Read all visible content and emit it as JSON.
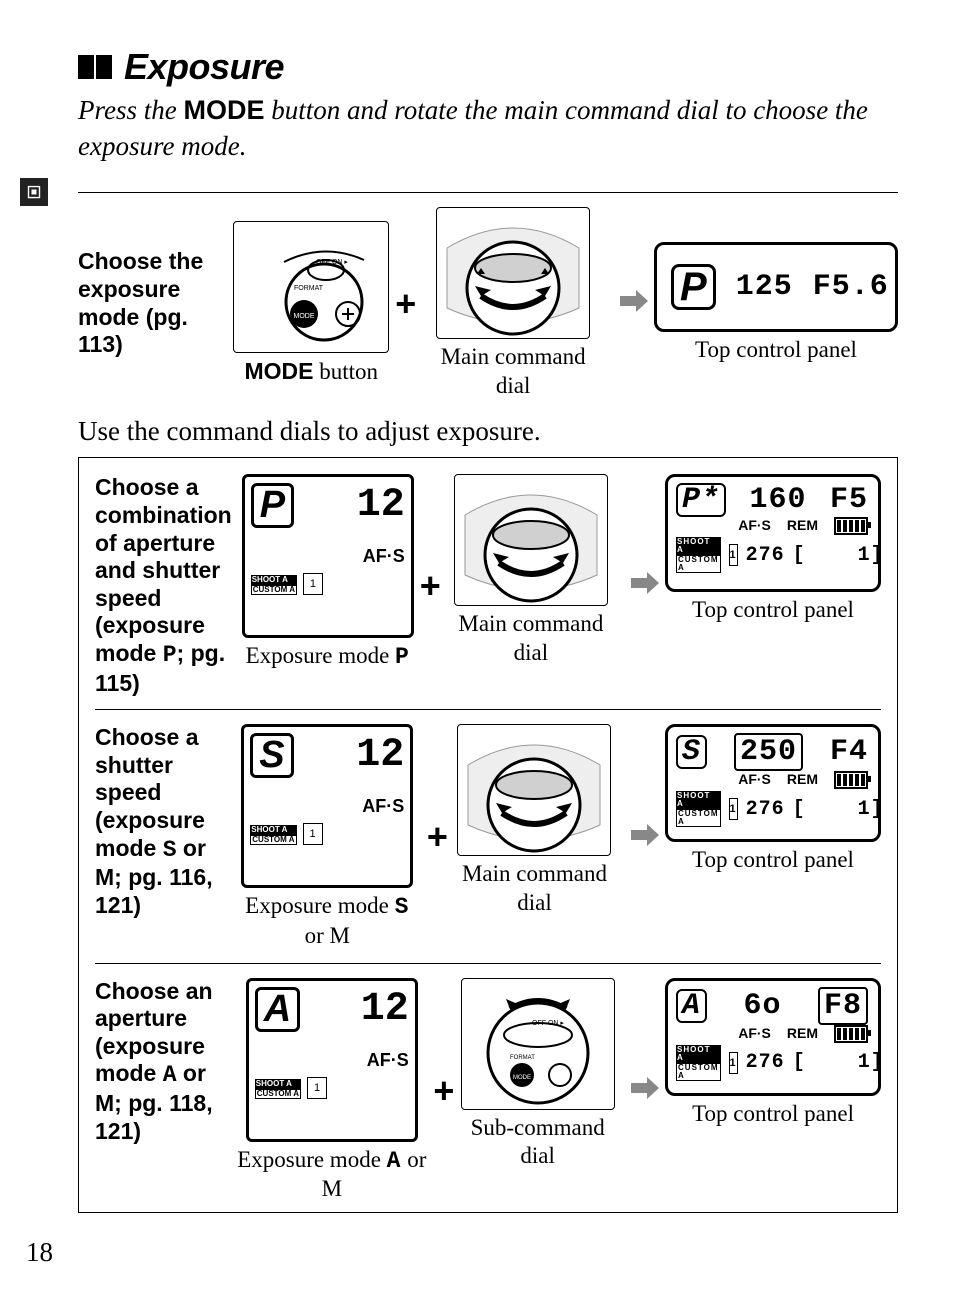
{
  "pageNumber": "18",
  "heading": "Exposure",
  "intro_prefix": "Press the ",
  "intro_mode": "MODE",
  "intro_suffix": " button and rotate the main command dial to choose the exposure mode.",
  "row1": {
    "desc": "Choose the exposure mode (pg. 113)",
    "cap1_pre": "",
    "cap1_mode": "MODE",
    "cap1_post": " button",
    "cap2": "Main command dial",
    "cap3": "Top control panel",
    "lcd_mode": "P",
    "lcd_shutter": "125",
    "lcd_aperture": "F5.6"
  },
  "midText": "Use the command dials to adjust exposure.",
  "rows": [
    {
      "desc_pre": "Choose a combination of aperture and shutter speed (exposure mode ",
      "desc_sym": "P",
      "desc_post": "; pg. 115)",
      "panel_mode": "P",
      "panel_num": "12",
      "panel_af": "AF·S",
      "panel_shoot": "SHOOT",
      "panel_shoot_b": "A",
      "panel_custom": "CUSTOM",
      "panel_custom_b": "A",
      "panel_mem": "1",
      "cap1_pre": "Exposure mode ",
      "cap1_sym": "P",
      "cap1_post": "",
      "cap2": "Main command dial",
      "cap3": "Top control panel",
      "dial": "main",
      "lcd_mode": "P*",
      "lcd_shutter": "160",
      "lcd_shutter_boxed": false,
      "lcd_aperture": "F5",
      "lcd_aperture_boxed": false,
      "lcd_af": "AF·S",
      "lcd_rem": "REM",
      "lcd_count": "276"
    },
    {
      "desc_pre": "Choose a shutter speed (exposure mode ",
      "desc_sym": "S",
      "desc_post": " or M; pg. 116, 121)",
      "panel_mode": "S",
      "panel_num": "12",
      "panel_af": "AF·S",
      "panel_shoot": "SHOOT",
      "panel_shoot_b": "A",
      "panel_custom": "CUSTOM",
      "panel_custom_b": "A",
      "panel_mem": "1",
      "cap1_pre": "Exposure mode ",
      "cap1_sym": "S",
      "cap1_post": " or M",
      "cap2": "Main command dial",
      "cap3": "Top control panel",
      "dial": "main",
      "lcd_mode": "S",
      "lcd_shutter": "250",
      "lcd_shutter_boxed": true,
      "lcd_aperture": "F4",
      "lcd_aperture_boxed": false,
      "lcd_af": "AF·S",
      "lcd_rem": "REM",
      "lcd_count": "276"
    },
    {
      "desc_pre": "Choose an aperture (exposure mode ",
      "desc_sym": "A",
      "desc_post": " or M; pg. 118, 121)",
      "panel_mode": "A",
      "panel_num": "12",
      "panel_af": "AF·S",
      "panel_shoot": "SHOOT",
      "panel_shoot_b": "A",
      "panel_custom": "CUSTOM",
      "panel_custom_b": "A",
      "panel_mem": "1",
      "cap1_pre": "Exposure mode ",
      "cap1_sym": "A",
      "cap1_post": " or M",
      "cap2": "Sub-command dial",
      "cap3": "Top control panel",
      "dial": "sub",
      "lcd_mode": "A",
      "lcd_shutter": "6o",
      "lcd_shutter_boxed": false,
      "lcd_aperture": "F8",
      "lcd_aperture_boxed": true,
      "lcd_af": "AF·S",
      "lcd_rem": "REM",
      "lcd_count": "276"
    }
  ]
}
